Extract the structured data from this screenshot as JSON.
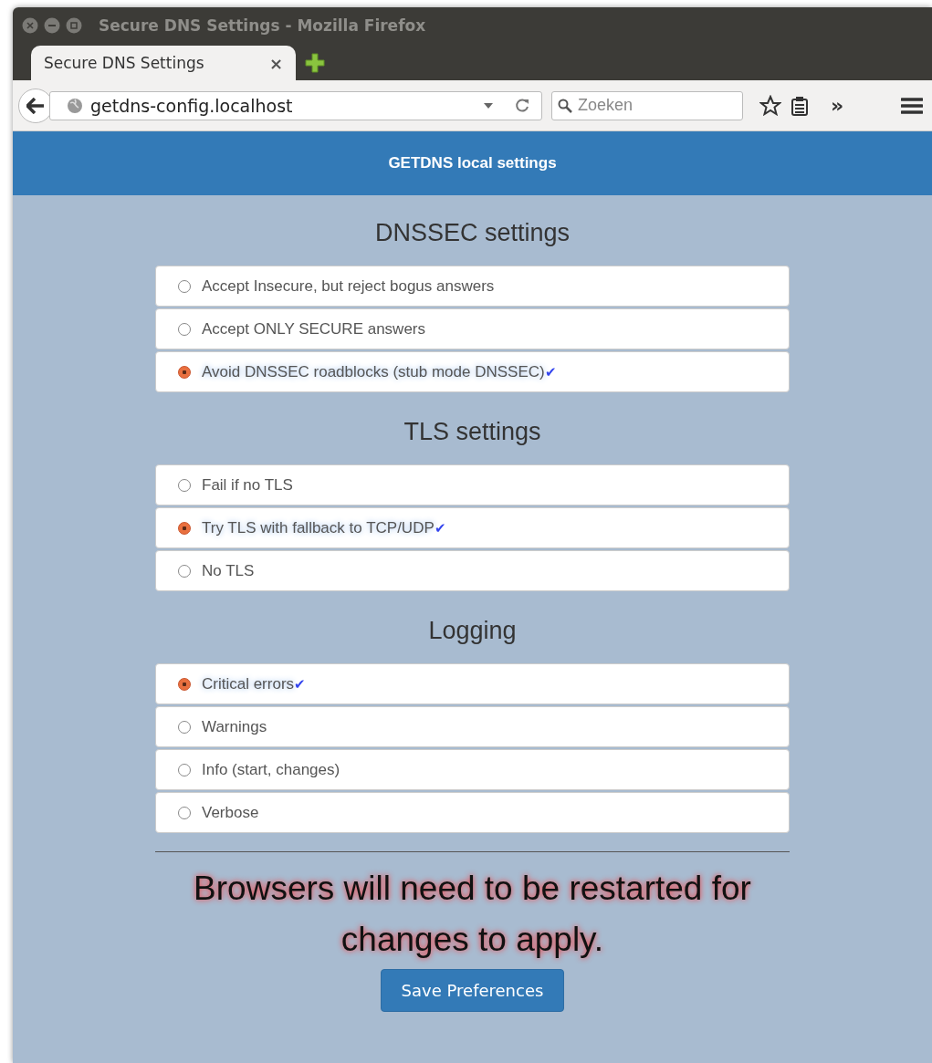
{
  "window": {
    "title": "Secure DNS Settings - Mozilla Firefox"
  },
  "tabs": [
    {
      "label": "Secure DNS Settings",
      "selected": true,
      "close": "×"
    }
  ],
  "address_bar": {
    "url": "getdns-config.localhost"
  },
  "search": {
    "placeholder": "Zoeken"
  },
  "overflow": "»",
  "header": {
    "title": "GETDNS local settings"
  },
  "sections": [
    {
      "title": "DNSSEC settings",
      "options": [
        {
          "label": "Accept Insecure, but reject bogus answers",
          "selected": false
        },
        {
          "label": "Accept ONLY SECURE answers",
          "selected": false
        },
        {
          "label": "Avoid DNSSEC roadblocks (stub mode DNSSEC)",
          "selected": true,
          "suffix": "✔"
        }
      ]
    },
    {
      "title": "TLS settings",
      "options": [
        {
          "label": "Fail if no TLS",
          "selected": false
        },
        {
          "label": "Try TLS with fallback to TCP/UDP",
          "selected": true,
          "suffix": "✔"
        },
        {
          "label": "No TLS",
          "selected": false
        }
      ]
    },
    {
      "title": "Logging",
      "options": [
        {
          "label": "Critical errors",
          "selected": true,
          "suffix": "✔"
        },
        {
          "label": "Warnings",
          "selected": false
        },
        {
          "label": "Info (start, changes)",
          "selected": false
        },
        {
          "label": "Verbose",
          "selected": false
        }
      ]
    }
  ],
  "notice": "Browsers will need to be restarted for changes to apply.",
  "save_button": "Save Preferences"
}
